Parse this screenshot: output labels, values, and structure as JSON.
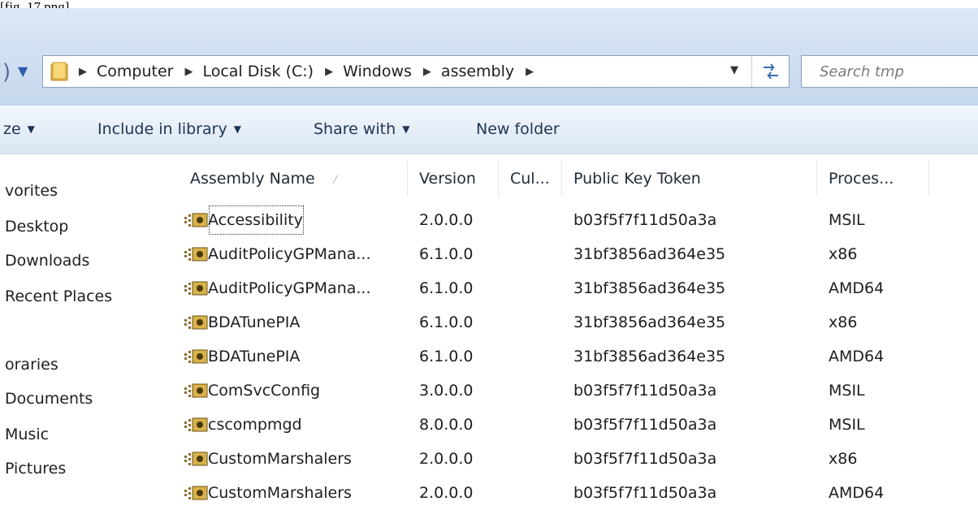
{
  "caption": "[fig_17.png]",
  "address": {
    "crumbs": [
      "Computer",
      "Local Disk (C:)",
      "Windows",
      "assembly"
    ],
    "search_placeholder": "Search tmp"
  },
  "toolbar": {
    "organize_label": "ze",
    "include_label": "Include in library",
    "share_label": "Share with",
    "new_folder_label": "New folder"
  },
  "nav": {
    "items": [
      "vorites",
      "Desktop",
      "Downloads",
      "Recent Places",
      "oraries",
      "Documents",
      "Music",
      "Pictures"
    ]
  },
  "table": {
    "columns": [
      "Assembly Name",
      "Version",
      "Cul...",
      "Public Key Token",
      "Proces..."
    ],
    "rows": [
      {
        "name": "Accessibility",
        "version": "2.0.0.0",
        "culture": "",
        "token": "b03f5f7f11d50a3a",
        "arch": "MSIL"
      },
      {
        "name": "AuditPolicyGPMana...",
        "version": "6.1.0.0",
        "culture": "",
        "token": "31bf3856ad364e35",
        "arch": "x86"
      },
      {
        "name": "AuditPolicyGPMana...",
        "version": "6.1.0.0",
        "culture": "",
        "token": "31bf3856ad364e35",
        "arch": "AMD64"
      },
      {
        "name": "BDATunePIA",
        "version": "6.1.0.0",
        "culture": "",
        "token": "31bf3856ad364e35",
        "arch": "x86"
      },
      {
        "name": "BDATunePIA",
        "version": "6.1.0.0",
        "culture": "",
        "token": "31bf3856ad364e35",
        "arch": "AMD64"
      },
      {
        "name": "ComSvcConfig",
        "version": "3.0.0.0",
        "culture": "",
        "token": "b03f5f7f11d50a3a",
        "arch": "MSIL"
      },
      {
        "name": "cscompmgd",
        "version": "8.0.0.0",
        "culture": "",
        "token": "b03f5f7f11d50a3a",
        "arch": "MSIL"
      },
      {
        "name": "CustomMarshalers",
        "version": "2.0.0.0",
        "culture": "",
        "token": "b03f5f7f11d50a3a",
        "arch": "x86"
      },
      {
        "name": "CustomMarshalers",
        "version": "2.0.0.0",
        "culture": "",
        "token": "b03f5f7f11d50a3a",
        "arch": "AMD64"
      }
    ]
  },
  "icons": {
    "folder": "folder-icon",
    "refresh": "refresh-icon",
    "assembly": "assembly-icon"
  },
  "colors": {
    "chrome_blue": "#d1e0f2",
    "text": "#1e1e1e",
    "link_blue": "#1e3552"
  }
}
